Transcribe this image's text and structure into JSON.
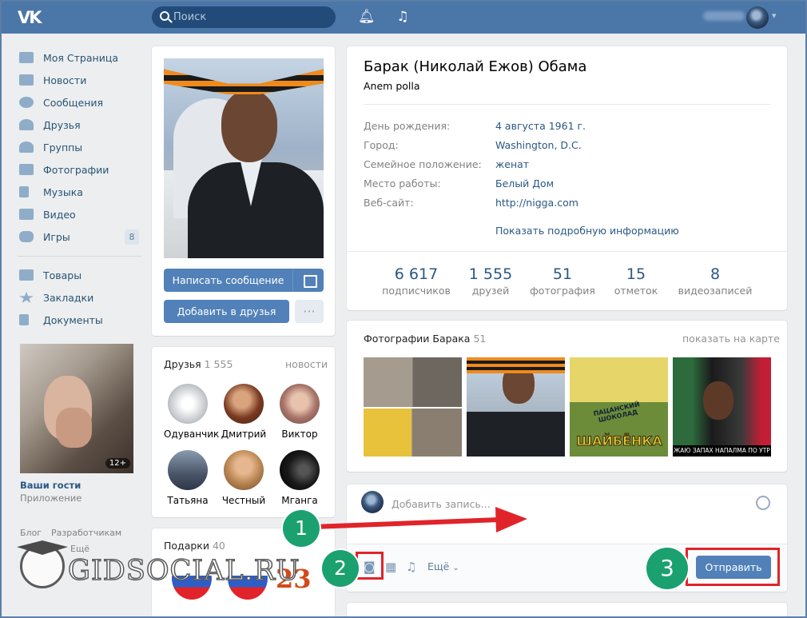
{
  "header": {
    "logo": "VK",
    "search_placeholder": "Поиск"
  },
  "nav": {
    "items": [
      {
        "label": "Моя Страница",
        "icon": "home-icon"
      },
      {
        "label": "Новости",
        "icon": "news-icon"
      },
      {
        "label": "Сообщения",
        "icon": "messages-icon"
      },
      {
        "label": "Друзья",
        "icon": "friends-icon"
      },
      {
        "label": "Группы",
        "icon": "groups-icon"
      },
      {
        "label": "Фотографии",
        "icon": "camera-icon"
      },
      {
        "label": "Музыка",
        "icon": "music-icon"
      },
      {
        "label": "Видео",
        "icon": "video-icon"
      },
      {
        "label": "Игры",
        "icon": "gamepad-icon",
        "badge": "8"
      }
    ],
    "items2": [
      {
        "label": "Товары",
        "icon": "bag-icon"
      },
      {
        "label": "Закладки",
        "icon": "star-icon"
      },
      {
        "label": "Документы",
        "icon": "document-icon"
      }
    ],
    "guest_badge": "12+",
    "guest_title": "Ваши гости",
    "guest_sub": "Приложение",
    "footer_links": [
      "Блог",
      "Разработчикам",
      "Ещё"
    ]
  },
  "profile_actions": {
    "message_button": "Написать сообщение",
    "add_friend_button": "Добавить в друзья",
    "more_button": "···"
  },
  "friends_block": {
    "title": "Друзья",
    "count": "1 555",
    "link": "новости",
    "friends": [
      "Одуванчик",
      "Дмитрий",
      "Виктор",
      "Татьяна",
      "Честный",
      "Мганга"
    ]
  },
  "gifts_block": {
    "title": "Подарки",
    "count": "40",
    "gift_text": "23"
  },
  "profile": {
    "name": "Барак (Николай Ежов) Обама",
    "status": "Anem polla",
    "info": [
      {
        "label": "День рождения:",
        "value": "4 августа 1961 г."
      },
      {
        "label": "Город:",
        "value": "Washington, D.C."
      },
      {
        "label": "Семейное положение:",
        "value": "женат"
      },
      {
        "label": "Место работы:",
        "value": "Белый Дом"
      },
      {
        "label": "Веб-сайт:",
        "value": "http://nigga.com"
      }
    ],
    "show_more": "Показать подробную информацию",
    "counters": [
      {
        "value": "6 617",
        "label": "подписчиков"
      },
      {
        "value": "1 555",
        "label": "друзей"
      },
      {
        "value": "51",
        "label": "фотография"
      },
      {
        "value": "15",
        "label": "отметок"
      },
      {
        "value": "8",
        "label": "видеозаписей"
      }
    ]
  },
  "photos_block": {
    "title": "Фотографии Барака",
    "count": "51",
    "link": "показать на карте",
    "tile2_book_text": "ПАЦАНСКИЙ ШОКОЛАД",
    "tile2_brand_text": "ШАЙБЁНКА",
    "tile4_caption": "ЖАЮ ЗАПАХ НАПАЛМА ПО УТР"
  },
  "post_box": {
    "placeholder": "Добавить запись...",
    "more_label": "Ещё",
    "send_button": "Отправить"
  },
  "annotations": {
    "callout_1": "1",
    "callout_2": "2",
    "callout_3": "3",
    "arrow_color": "#e0242a",
    "callout_color": "#1aa16f"
  },
  "watermark": {
    "text": "GIDSOCIAL.RU"
  }
}
